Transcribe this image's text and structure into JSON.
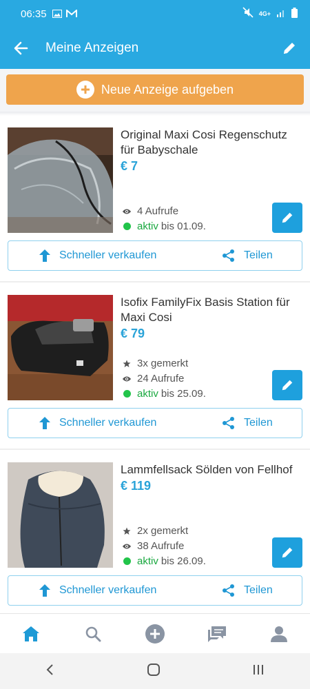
{
  "status_bar": {
    "time": "06:35",
    "network": "4G+"
  },
  "app_bar": {
    "title": "Meine Anzeigen"
  },
  "new_ad_button": {
    "label": "Neue Anzeige aufgeben"
  },
  "colors": {
    "primary": "#29a9e1",
    "accent_orange": "#efa44c",
    "active_green": "#22c44a",
    "price_blue": "#2aa3d8"
  },
  "listings": [
    {
      "title": "Original Maxi Cosi Regenschutz für Babyschale",
      "price": "€ 7",
      "views": "4 Aufrufe",
      "status": "aktiv",
      "until": "bis 01.09."
    },
    {
      "title": "Isofix FamilyFix Basis Station für Maxi Cosi",
      "price": "€ 79",
      "saved": "3x gemerkt",
      "views": "24 Aufrufe",
      "status": "aktiv",
      "until": "bis 25.09."
    },
    {
      "title": "Lammfellsack Sölden von Fellhof",
      "price": "€ 119",
      "saved": "2x gemerkt",
      "views": "38 Aufrufe",
      "status": "aktiv",
      "until": "bis 26.09."
    }
  ],
  "actions": {
    "sell_faster": "Schneller verkaufen",
    "share": "Teilen"
  },
  "bottom_nav": [
    "home-icon",
    "search-icon",
    "add-icon",
    "messages-icon",
    "profile-icon"
  ],
  "system_nav": [
    "back-icon",
    "home-circle-icon",
    "recents-icon"
  ]
}
